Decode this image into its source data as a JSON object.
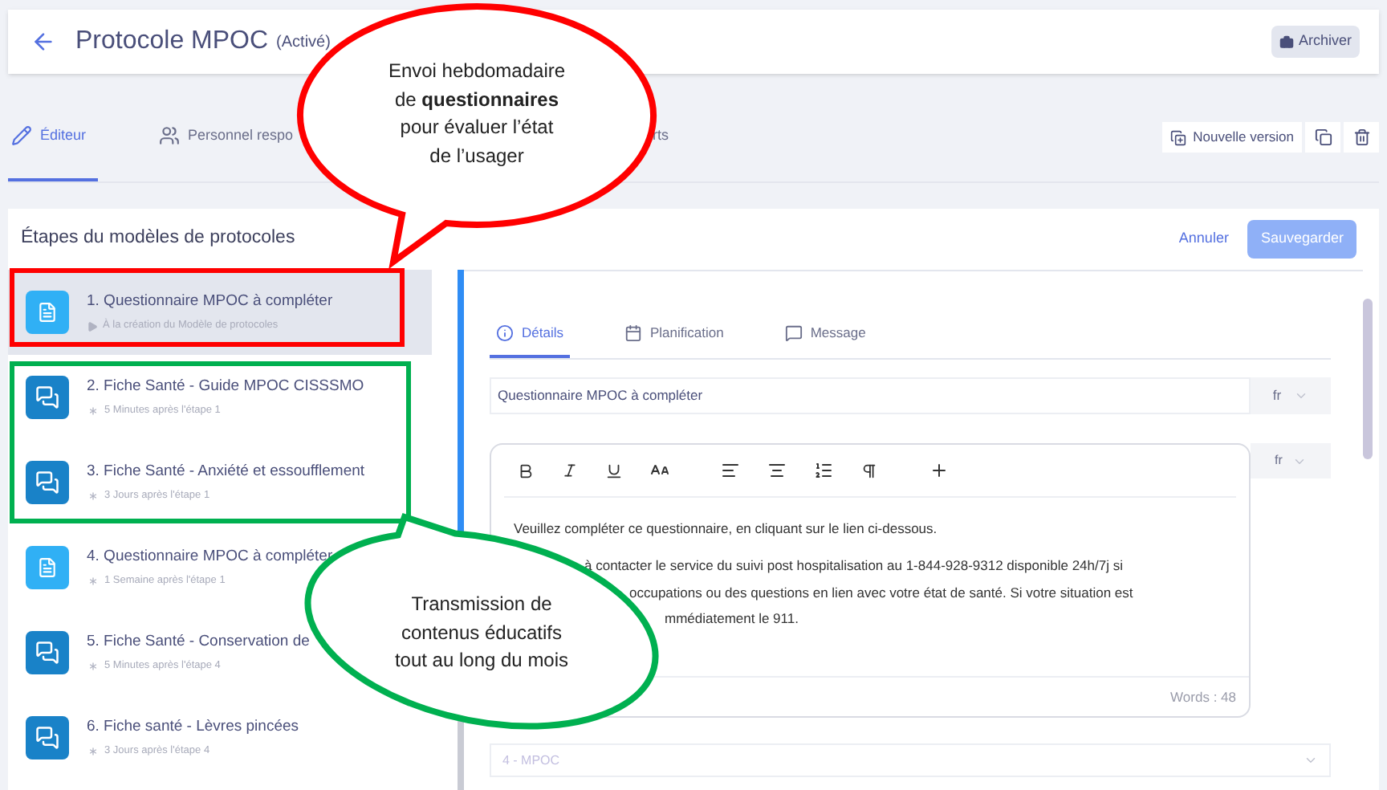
{
  "header": {
    "title": "Protocole MPOC",
    "status": "(Activé)",
    "archive_button": "Archiver"
  },
  "tabs": [
    {
      "label": "Éditeur",
      "selected": true
    },
    {
      "label": "Personnel respo",
      "selected": false
    },
    {
      "label": "rts",
      "selected": false
    }
  ],
  "toolbar": {
    "new_version": "Nouvelle version"
  },
  "steps_panel": {
    "title": "Étapes du modèles de protocoles",
    "cancel": "Annuler",
    "save": "Sauvegarder"
  },
  "steps": [
    {
      "kind": "questionnaire",
      "title": "1. Questionnaire MPOC à compléter",
      "timing": {
        "kind": "creation",
        "text": "À la création du Modèle de protocoles"
      },
      "selected": true
    },
    {
      "kind": "sheet",
      "title": "2. Fiche Santé - Guide MPOC CISSSMO",
      "timing": {
        "kind": "delay",
        "text": "5 Minutes après l'étape 1"
      },
      "selected": false
    },
    {
      "kind": "sheet",
      "title": "3. Fiche Santé - Anxiété et essoufflement",
      "timing": {
        "kind": "delay",
        "text": "3 Jours après l'étape 1"
      },
      "selected": false
    },
    {
      "kind": "questionnaire",
      "title": "4. Questionnaire MPOC à compléter",
      "timing": {
        "kind": "delay",
        "text": "1 Semaine après l'étape 1"
      },
      "selected": false
    },
    {
      "kind": "sheet",
      "title": "5. Fiche Santé - Conservation de",
      "timing": {
        "kind": "delay",
        "text": "5 Minutes après l'étape 4"
      },
      "selected": false
    },
    {
      "kind": "sheet",
      "title": "6. Fiche santé - Lèvres pincées",
      "timing": {
        "kind": "delay",
        "text": "3 Jours après l'étape 4"
      },
      "selected": false
    }
  ],
  "detail_tabs": [
    {
      "kind": "details",
      "label": "Détails",
      "selected": true
    },
    {
      "kind": "schedule",
      "label": "Planification",
      "selected": false
    },
    {
      "kind": "message",
      "label": "Message",
      "selected": false
    }
  ],
  "name_field": {
    "value": "Questionnaire MPOC à compléter",
    "language": "fr"
  },
  "editor": {
    "language": "fr",
    "first_paragraph": "Veuillez compléter ce questionnaire, en cliquant sur le lien ci-dessous.",
    "visible_fragments": [
      "à contacter le service du suivi post hospitalisation au 1-844-928-9312 disponible 24h/7j si",
      "occupations ou des questions en lien avec votre état de santé. Si votre situation est",
      "mmédiatement le 911."
    ],
    "word_count": "Words : 48"
  },
  "category_select": {
    "placeholder": "4 - MPOC"
  },
  "annotations": {
    "frames": [
      {
        "color": "#ff0000"
      },
      {
        "color": "#00b050"
      }
    ],
    "bubbles": [
      {
        "color": "#ff0000",
        "lines": [
          "Envoi hebdomadaire",
          "de **questionnaires**",
          "pour évaluer l’état",
          "de l’usager"
        ]
      },
      {
        "color": "#00b050",
        "lines": [
          "Transmission de",
          "contenus éducatifs",
          "tout au long du mois"
        ]
      }
    ]
  }
}
